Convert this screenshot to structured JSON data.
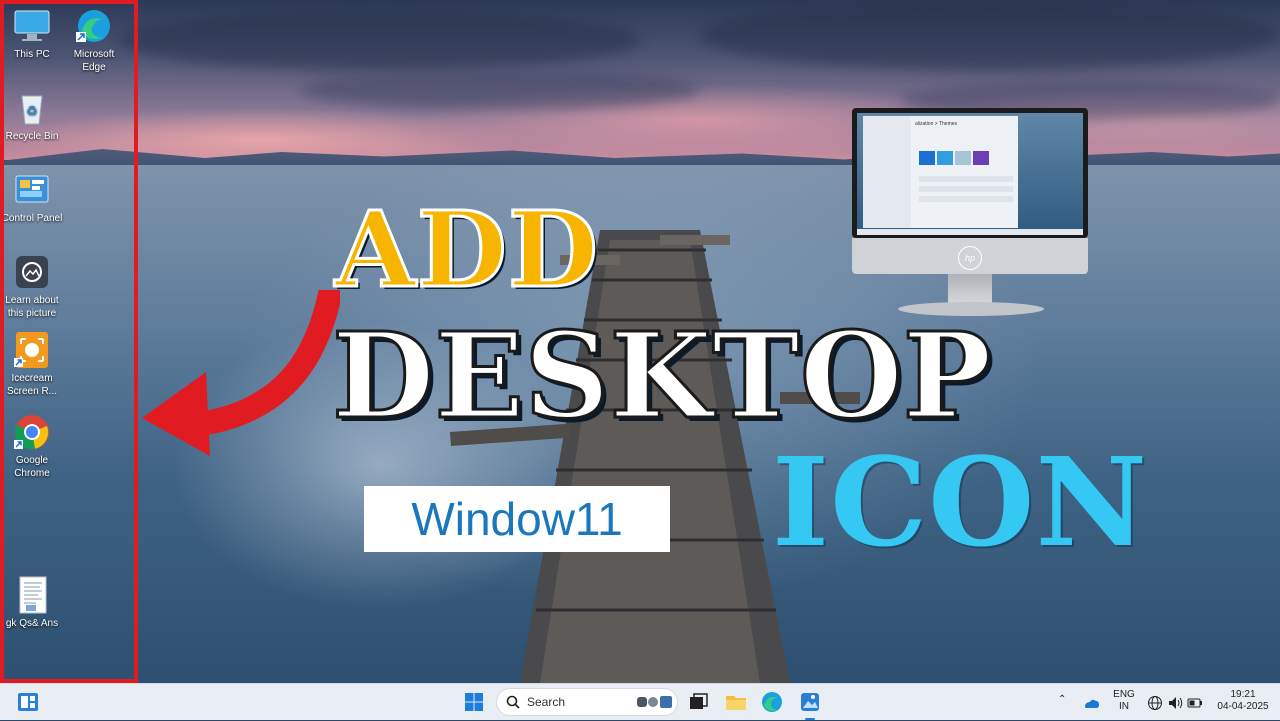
{
  "desktop": {
    "icons": [
      {
        "label": "This PC",
        "icon": "monitor-icon"
      },
      {
        "label": "Microsoft Edge",
        "icon": "edge-icon"
      },
      {
        "label": "Recycle Bin",
        "icon": "recycle-bin-icon"
      },
      {
        "label": "Control Panel",
        "icon": "control-panel-icon"
      },
      {
        "label": "Learn about this picture",
        "icon": "camera-icon"
      },
      {
        "label": "Icecream Screen R...",
        "icon": "icecream-icon"
      },
      {
        "label": "Google Chrome",
        "icon": "chrome-icon"
      },
      {
        "label": "gk Qs& Ans",
        "icon": "document-icon"
      }
    ],
    "highlight_color": "#e11b22"
  },
  "overlay": {
    "line1": "ADD",
    "line2": "DESKTOP",
    "line3": "ICON",
    "badge": "Window11",
    "colors": {
      "add": "#f7b500",
      "desktop": "#ffffff",
      "icon": "#35c8f2",
      "badge": "#1a77bd",
      "arrow": "#e11b22"
    }
  },
  "monitor": {
    "brand": "hp",
    "screen_breadcrumb": "alization  >  Themes"
  },
  "taskbar": {
    "search_placeholder": "Search",
    "language": {
      "line1": "ENG",
      "line2": "IN"
    },
    "clock": {
      "time": "19:21",
      "date": "04-04-2025"
    }
  }
}
